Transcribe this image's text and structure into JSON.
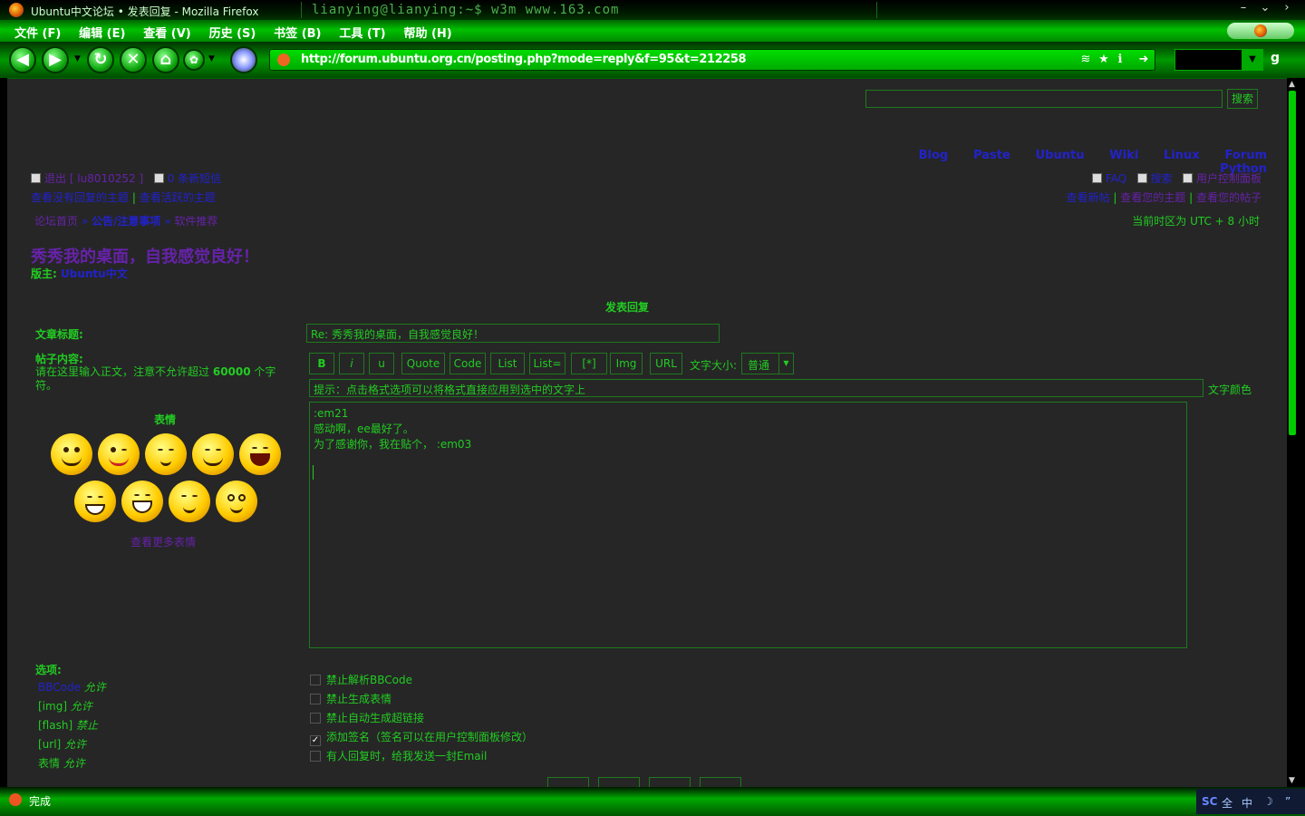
{
  "window": {
    "title": "Ubuntu中文论坛 • 发表回复 - Mozilla Firefox",
    "terminal_prompt": "lianying@lianying:~$ w3m www.163.com"
  },
  "menubar": [
    "文件 (F)",
    "编辑 (E)",
    "查看 (V)",
    "历史 (S)",
    "书签 (B)",
    "工具 (T)",
    "帮助 (H)"
  ],
  "navbar": {
    "url": "http://forum.ubuntu.org.cn/posting.php?mode=reply&f=95&t=212258",
    "icons": [
      "back-icon",
      "forward-icon",
      "reload-icon",
      "stop-icon",
      "home-icon",
      "addon-icon",
      "globe-icon"
    ]
  },
  "site": {
    "search_button": "搜索",
    "top_nav": [
      "Blog",
      "Paste",
      "Ubuntu",
      "Wiki",
      "Linux",
      "Forum",
      "Python"
    ],
    "logout": "退出 [ lu8010252 ]",
    "new_messages": "0 条新短信",
    "unanswered": "查看没有回复的主题",
    "active": "查看活跃的主题",
    "faq": "FAQ",
    "search": "搜索",
    "ucp": "用户控制面板",
    "new_posts": "查看新帖",
    "your_topics": "查看您的主题",
    "your_posts": "查看您的帖子",
    "separator": "|",
    "breadcrumb_sep": "»",
    "breadcrumb": [
      "论坛首页",
      "公告/注意事项",
      "软件推荐"
    ],
    "timezone": "当前时区为 UTC + 8 小时"
  },
  "topic": {
    "title": "秀秀我的桌面，自我感觉良好！",
    "moderator_label": "版主:",
    "moderator": "Ubuntu中文"
  },
  "form": {
    "heading": "发表回复",
    "subject_label": "文章标题:",
    "subject_value": "Re: 秀秀我的桌面，自我感觉良好！",
    "content_label": "帖子内容:",
    "content_hint_1": "请在这里输入正文，注意不允许超过",
    "content_hint_num": "60000",
    "content_hint_2": "个字符。",
    "buttons": [
      "B",
      "i",
      "u",
      "Quote",
      "Code",
      "List",
      "List=",
      "[*]",
      "Img",
      "URL"
    ],
    "size_label": "文字大小:",
    "size_value": "普通",
    "tip": "提示：点击格式选项可以将格式直接应用到选中的文字上",
    "color_label": "文字颜色",
    "message_lines": [
      ":em21",
      "感动啊，ee最好了。",
      "为了感谢你，我在贴个， :em03"
    ],
    "smilies_label": "表情",
    "more_smilies": "查看更多表情"
  },
  "options": {
    "label": "选项:",
    "rows": [
      {
        "name": "BBCode",
        "status": "允许"
      },
      {
        "name": "[img]",
        "status": "允许"
      },
      {
        "name": "[flash]",
        "status": "禁止"
      },
      {
        "name": "[url]",
        "status": "允许"
      },
      {
        "name": "表情",
        "status": "允许"
      }
    ],
    "checkboxes": [
      {
        "label": "禁止解析BBCode",
        "checked": false
      },
      {
        "label": "禁止生成表情",
        "checked": false
      },
      {
        "label": "禁止自动生成超链接",
        "checked": false
      },
      {
        "label": "添加签名（签名可以在用户控制面板修改）",
        "checked": true
      },
      {
        "label": "有人回复时，给我发送一封Email",
        "checked": false
      }
    ]
  },
  "status": {
    "text": "完成",
    "tray": [
      "全",
      "中"
    ]
  },
  "colors": {
    "accent": "#22cc22",
    "link": "#2222cc",
    "visited": "#6622aa",
    "background": "#262626"
  }
}
